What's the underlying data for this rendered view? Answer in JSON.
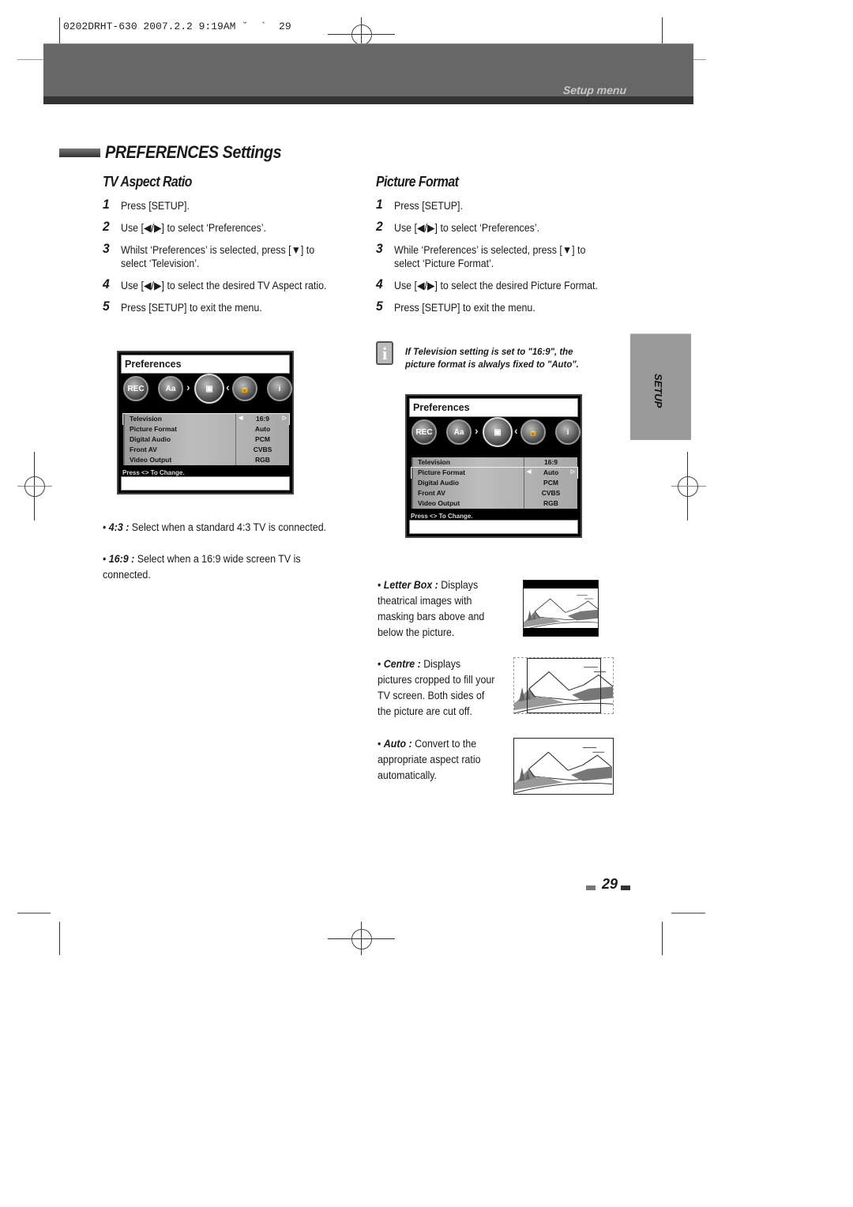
{
  "print_slug": "0202DRHT-630 2007.2.2 9:19AM ˘  `  29",
  "header": {
    "section_label": "Setup menu"
  },
  "section_title": "PREFERENCES Settings",
  "side_tab": {
    "label": "SETUP"
  },
  "tv_aspect_ratio": {
    "title": "TV Aspect Ratio",
    "steps": [
      {
        "num": "1",
        "text": "Press [SETUP]."
      },
      {
        "num": "2",
        "text": "Use [◀/▶] to select ‘Preferences’."
      },
      {
        "num": "3",
        "text": "Whilst ‘Preferences’ is selected, press [▼] to select ‘Television’."
      },
      {
        "num": "4",
        "text": "Use [◀/▶] to select the desired TV Aspect ratio."
      },
      {
        "num": "5",
        "text": "Press [SETUP] to exit the menu."
      }
    ],
    "osd": {
      "title": "Preferences",
      "icons": [
        "REC",
        "Aa",
        "",
        "",
        "i"
      ],
      "rows": [
        {
          "label": "Television",
          "value": "16:9",
          "selected": true
        },
        {
          "label": "Picture Format",
          "value": "Auto",
          "selected": false
        },
        {
          "label": "Digital Audio",
          "value": "PCM",
          "selected": false
        },
        {
          "label": "Front AV",
          "value": "CVBS",
          "selected": false
        },
        {
          "label": "Video Output",
          "value": "RGB",
          "selected": false
        }
      ],
      "hint": "Press <> To Change."
    },
    "options": [
      {
        "term": "4:3 :",
        "text": " Select when a standard 4:3 TV is connected."
      },
      {
        "term": "16:9 :",
        "text": " Select when a 16:9 wide screen TV is connected."
      }
    ]
  },
  "picture_format": {
    "title": "Picture Format",
    "steps": [
      {
        "num": "1",
        "text": "Press [SETUP]."
      },
      {
        "num": "2",
        "text": "Use [◀/▶] to select ‘Preferences’."
      },
      {
        "num": "3",
        "text": "While ‘Preferences’ is selected, press [▼] to select ‘Picture Format’."
      },
      {
        "num": "4",
        "text": "Use [◀/▶] to select the desired  Picture Format."
      },
      {
        "num": "5",
        "text": "Press [SETUP] to exit the menu."
      }
    ],
    "note": "If Television setting is set to \"16:9\", the picture format is alwalys fixed to \"Auto\".",
    "osd": {
      "title": "Preferences",
      "icons": [
        "REC",
        "Aa",
        "",
        "",
        "i"
      ],
      "rows": [
        {
          "label": "Television",
          "value": "16:9",
          "selected": false
        },
        {
          "label": "Picture Format",
          "value": "Auto",
          "selected": true
        },
        {
          "label": "Digital Audio",
          "value": "PCM",
          "selected": false
        },
        {
          "label": "Front AV",
          "value": "CVBS",
          "selected": false
        },
        {
          "label": "Video Output",
          "value": "RGB",
          "selected": false
        }
      ],
      "hint": "Press <> To Change."
    },
    "options": [
      {
        "term": "Letter Box :",
        "text": " Displays theatrical images with masking bars above and below the picture."
      },
      {
        "term": "Centre :",
        "text": " Displays pictures cropped to fill your TV screen. Both sides of the picture are cut off."
      },
      {
        "term": "Auto :",
        "text": " Convert to the appropriate aspect ratio automatically."
      }
    ]
  },
  "page_number": "29"
}
